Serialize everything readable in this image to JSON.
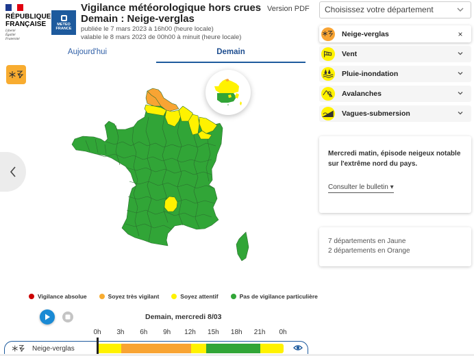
{
  "header": {
    "republic_lines": [
      "RÉPUBLIQUE",
      "FRANÇAISE"
    ],
    "motto_lines": [
      "Liberté",
      "Égalité",
      "Fraternité"
    ],
    "meteo_logo_lines": [
      "METEO",
      "FRANCE"
    ],
    "title_line1": "Vigilance météorologique hors crues",
    "title_line2": "Demain : Neige-verglas",
    "published": "publiée le 7 mars 2023 à 16h00 (heure locale)",
    "valid": "valable le 8 mars 2023 de 00h00 à minuit (heure locale)",
    "pdf_link": "Version PDF"
  },
  "tabs": [
    {
      "label": "Aujourd'hui",
      "active": false
    },
    {
      "label": "Demain",
      "active": true
    }
  ],
  "selected_phenomenon_icon": "snow-ice-icon",
  "colors": {
    "red": "#cc0000",
    "orange": "#f8a433",
    "yellow": "#fff200",
    "green": "#31a537",
    "accent_blue": "#1d5a9d"
  },
  "map": {
    "departments_yellow": 7,
    "departments_orange": 2
  },
  "legend": [
    {
      "label": "Vigilance absolue",
      "color": "#cc0000"
    },
    {
      "label": "Soyez très vigilant",
      "color": "#f8ac30"
    },
    {
      "label": "Soyez attentif",
      "color": "#fff200"
    },
    {
      "label": "Pas de vigilance particulière",
      "color": "#31a537"
    }
  ],
  "player": {
    "day_label": "Demain, mercredi 8/03",
    "hours": [
      "0h",
      "3h",
      "6h",
      "9h",
      "12h",
      "15h",
      "18h",
      "21h",
      "0h"
    ],
    "current_hour": 0
  },
  "timeline": {
    "label": "Neige-verglas",
    "segments": [
      {
        "from_h": 0,
        "to_h": 3,
        "level": "yellow"
      },
      {
        "from_h": 3,
        "to_h": 12,
        "level": "orange"
      },
      {
        "from_h": 12,
        "to_h": 14,
        "level": "yellow"
      },
      {
        "from_h": 14,
        "to_h": 21,
        "level": "green"
      },
      {
        "from_h": 21,
        "to_h": 24,
        "level": "yellow"
      }
    ]
  },
  "sidebar": {
    "dept_select_placeholder": "Choisissez votre département",
    "phenomena": [
      {
        "label": "Neige-verglas",
        "icon": "snow-ice-icon",
        "level": "orange",
        "active": true,
        "control": "×"
      },
      {
        "label": "Vent",
        "icon": "wind-icon",
        "level": "yellow",
        "active": false,
        "control": "⌄"
      },
      {
        "label": "Pluie-inondation",
        "icon": "rain-flood-icon",
        "level": "yellow",
        "active": false,
        "control": "⌄"
      },
      {
        "label": "Avalanches",
        "icon": "avalanche-icon",
        "level": "yellow",
        "active": false,
        "control": "⌄"
      },
      {
        "label": "Vagues-submersion",
        "icon": "waves-icon",
        "level": "yellow",
        "active": false,
        "control": "⌄"
      }
    ],
    "bulletin_text": "Mercredi matin, épisode neigeux notable sur l'extrême nord du pays.",
    "bulletin_link": "Consulter le bulletin ▾",
    "counts": [
      "7 départements en Jaune",
      "2 départements en Orange"
    ]
  }
}
